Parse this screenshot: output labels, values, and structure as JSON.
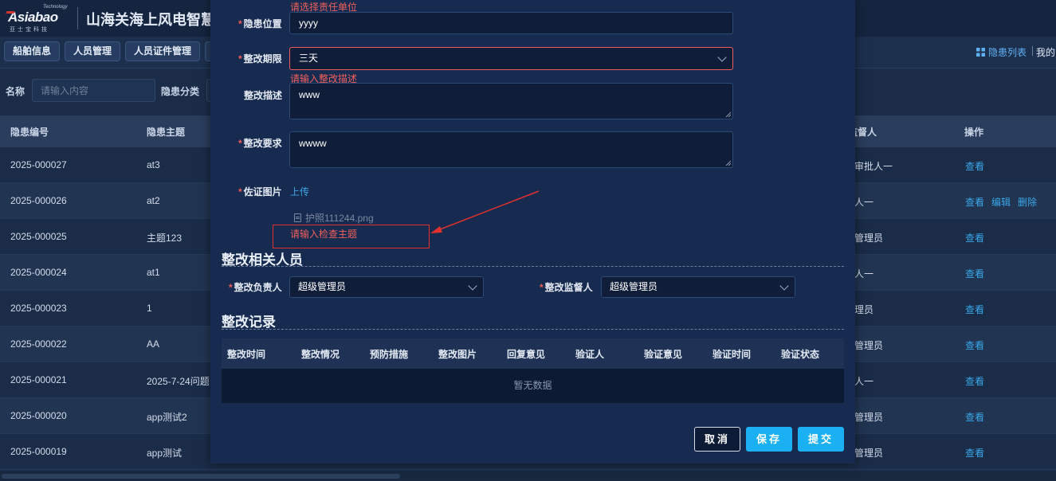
{
  "header": {
    "logo_tech": "Technology",
    "logo_word": "Asiabao",
    "logo_cn": "亚士宝科技",
    "title": "山海关海上风电智慧"
  },
  "nav": {
    "tabs": [
      "船舶信息",
      "人员管理",
      "人员证件管理"
    ],
    "right_link": "隐患列表",
    "right_mine": "我的"
  },
  "filter": {
    "name_label": "名称",
    "name_placeholder": "请输入内容",
    "category_label": "隐患分类"
  },
  "table": {
    "headers": {
      "code": "隐患编号",
      "subject": "隐患主题",
      "supervisor": "监督人",
      "actions": "操作"
    },
    "rows": [
      {
        "code": "2025-000027",
        "subject": "at3",
        "person": "审批人一",
        "actions": [
          "查看"
        ]
      },
      {
        "code": "2025-000026",
        "subject": "at2",
        "person": "人一",
        "actions": [
          "查看",
          "编辑",
          "删除"
        ]
      },
      {
        "code": "2025-000025",
        "subject": "主题123",
        "person": "管理员",
        "actions": [
          "查看"
        ]
      },
      {
        "code": "2025-000024",
        "subject": "at1",
        "person": "人一",
        "actions": [
          "查看"
        ]
      },
      {
        "code": "2025-000023",
        "subject": "1",
        "person": "理员",
        "actions": [
          "查看"
        ]
      },
      {
        "code": "2025-000022",
        "subject": "AA",
        "person": "管理员",
        "actions": [
          "查看"
        ]
      },
      {
        "code": "2025-000021",
        "subject": "2025-7-24问题",
        "person": "人一",
        "actions": [
          "查看"
        ]
      },
      {
        "code": "2025-000020",
        "subject": "app测试2",
        "person": "管理员",
        "actions": [
          "查看"
        ]
      },
      {
        "code": "2025-000019",
        "subject": "app测试",
        "person": "管理员",
        "actions": [
          "查看"
        ]
      }
    ]
  },
  "modal": {
    "err_unit": "请选择责任单位",
    "location": {
      "label": "隐患位置",
      "value": "yyyy"
    },
    "deadline": {
      "label": "整改期限",
      "value": "三天"
    },
    "err_desc": "请输入整改描述",
    "description": {
      "label": "整改描述",
      "value": "www"
    },
    "requirement": {
      "label": "整改要求",
      "value": "wwww"
    },
    "evidence": {
      "label": "佐证图片",
      "upload": "上传",
      "file": "护照111244.png"
    },
    "err_subject": "请输入检查主题",
    "people_section": "整改相关人员",
    "owner": {
      "label": "整改负责人",
      "value": "超级管理员"
    },
    "supervisor": {
      "label": "整改监督人",
      "value": "超级管理员"
    },
    "records_section": "整改记录",
    "records_headers": [
      "整改时间",
      "整改情况",
      "预防措施",
      "整改图片",
      "回复意见",
      "验证人",
      "验证意见",
      "验证时间",
      "验证状态"
    ],
    "records_empty": "暂无数据",
    "buttons": {
      "cancel": "取消",
      "save": "保存",
      "submit": "提交"
    }
  },
  "colors": {
    "accent": "#1ab0f2",
    "link": "#3aa7e8",
    "error": "#f0605c",
    "modal_bg": "#172a4f"
  }
}
